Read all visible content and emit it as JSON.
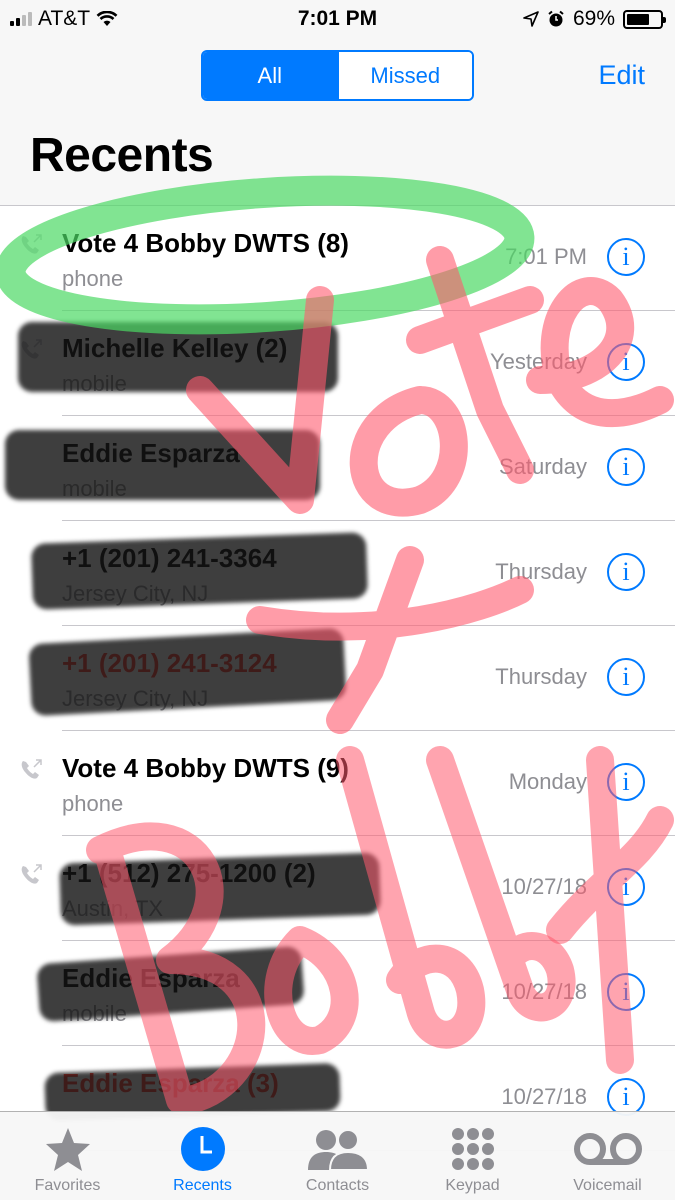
{
  "status_bar": {
    "carrier": "AT&T",
    "time": "7:01 PM",
    "battery_percent": "69%",
    "battery_level": 0.69,
    "icons": [
      "signal-icon",
      "wifi-icon",
      "location-icon",
      "alarm-icon",
      "battery-icon"
    ]
  },
  "nav": {
    "segments": [
      {
        "label": "All",
        "selected": true
      },
      {
        "label": "Missed",
        "selected": false
      }
    ],
    "edit_label": "Edit",
    "title": "Recents"
  },
  "calls": [
    {
      "name": "Vote 4 Bobby DWTS (8)",
      "subtitle": "phone",
      "when": "7:01 PM",
      "missed": false,
      "outgoing_icon": true
    },
    {
      "name": "Michelle Kelley (2)",
      "subtitle": "mobile",
      "when": "Yesterday",
      "missed": false,
      "outgoing_icon": true
    },
    {
      "name": "Eddie Esparza",
      "subtitle": "mobile",
      "when": "Saturday",
      "missed": false,
      "outgoing_icon": false
    },
    {
      "name": "+1 (201) 241-3364",
      "subtitle": "Jersey City, NJ",
      "when": "Thursday",
      "missed": false,
      "outgoing_icon": false
    },
    {
      "name": "+1 (201) 241-3124",
      "subtitle": "Jersey City, NJ",
      "when": "Thursday",
      "missed": true,
      "outgoing_icon": false
    },
    {
      "name": "Vote 4 Bobby DWTS (9)",
      "subtitle": "phone",
      "when": "Monday",
      "missed": false,
      "outgoing_icon": true
    },
    {
      "name": "+1 (512) 275-1200 (2)",
      "subtitle": "Austin, TX",
      "when": "10/27/18",
      "missed": false,
      "outgoing_icon": true
    },
    {
      "name": "Eddie Esparza",
      "subtitle": "mobile",
      "when": "10/27/18",
      "missed": false,
      "outgoing_icon": false
    },
    {
      "name": "Eddie Esparza (3)",
      "subtitle": "",
      "when": "10/27/18",
      "missed": true,
      "outgoing_icon": false
    }
  ],
  "info_glyph": "i",
  "tabs": [
    {
      "label": "Favorites",
      "icon": "star-icon",
      "active": false
    },
    {
      "label": "Recents",
      "icon": "clock-icon",
      "active": true
    },
    {
      "label": "Contacts",
      "icon": "contacts-icon",
      "active": false
    },
    {
      "label": "Keypad",
      "icon": "keypad-icon",
      "active": false
    },
    {
      "label": "Voicemail",
      "icon": "voicemail-icon",
      "active": false
    }
  ],
  "annotations": {
    "handwritten_text": "Vote 4 Bobby",
    "red_marker_color": "#ff5a6e",
    "green_marker_color": "#4cd964",
    "redaction_color": "#141414"
  },
  "colors": {
    "accent": "#007aff",
    "missed": "#ff3b30",
    "secondary_text": "#8e8e93"
  }
}
